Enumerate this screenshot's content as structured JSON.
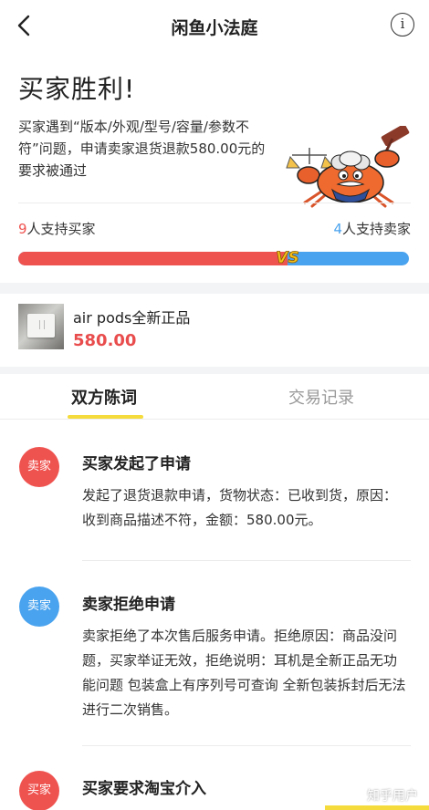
{
  "nav": {
    "title": "闲鱼小法庭",
    "info_glyph": "i"
  },
  "verdict": {
    "headline": "买家胜利!",
    "description": "买家遇到“版本/外观/型号/容量/参数不符”问题，申请卖家退货退款580.00元的要求被通过"
  },
  "support": {
    "buyer_count": "9",
    "buyer_label": "人支持买家",
    "seller_count": "4",
    "seller_label": "人支持卖家",
    "buyer_fraction": 0.69,
    "vs_text": "VS"
  },
  "product": {
    "name": "air pods全新正品",
    "price": "580.00"
  },
  "tabs": [
    {
      "label": "双方陈词",
      "active": true
    },
    {
      "label": "交易记录",
      "active": false
    }
  ],
  "entries": [
    {
      "avatar": "卖家",
      "title": "买家发起了申请",
      "body": "发起了退货退款申请，货物状态：已收到货，原因：收到商品描述不符，金额：580.00元。"
    },
    {
      "avatar": "卖家",
      "title": "卖家拒绝申请",
      "body": "卖家拒绝了本次售后服务申请。拒绝原因：商品没问题，买家举证无效，拒绝说明：耳机是全新正品无功能问题 包装盒上有序列号可查询 全新包装拆封后无法进行二次销售。"
    },
    {
      "avatar": "买家",
      "title": "买家要求淘宝介入",
      "body": ""
    }
  ],
  "watermark": "知乎用户",
  "colors": {
    "buyer_red": "#ef5350",
    "seller_blue": "#4aa3ee",
    "accent_yellow": "#f5dc3c",
    "price_red": "#e94c4c"
  },
  "icons": {
    "back": "chevron-left-icon",
    "info": "info-icon",
    "mascot": "crab-judge-icon"
  }
}
